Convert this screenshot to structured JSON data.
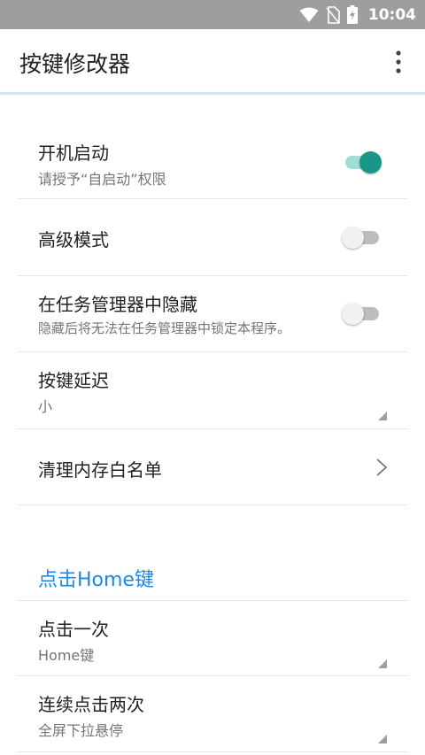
{
  "status_bar": {
    "time": "10:04",
    "icons": [
      "wifi-icon",
      "no-sim-icon",
      "battery-charging-icon"
    ]
  },
  "app_bar": {
    "title": "按键修改器",
    "menu_icon": "more-vert-icon"
  },
  "settings": {
    "boot_start": {
      "title": "开机启动",
      "summary": "请授予“自启动”权限",
      "enabled": true
    },
    "advanced_mode": {
      "title": "高级模式",
      "enabled": false
    },
    "hide_in_task_manager": {
      "title": "在任务管理器中隐藏",
      "summary": "隐藏后将无法在任务管理器中锁定本程序。",
      "enabled": false
    },
    "key_delay": {
      "title": "按键延迟",
      "value": "小"
    },
    "memory_whitelist": {
      "title": "清理内存白名单"
    }
  },
  "home_section": {
    "header": "点击Home键",
    "single_click": {
      "title": "点击一次",
      "value": "Home键"
    },
    "double_click": {
      "title": "连续点击两次",
      "value": "全屏下拉悬停"
    }
  },
  "colors": {
    "accent": "#1a9688",
    "section_header": "#1e88e5",
    "status_bar": "#9e9e9e"
  }
}
